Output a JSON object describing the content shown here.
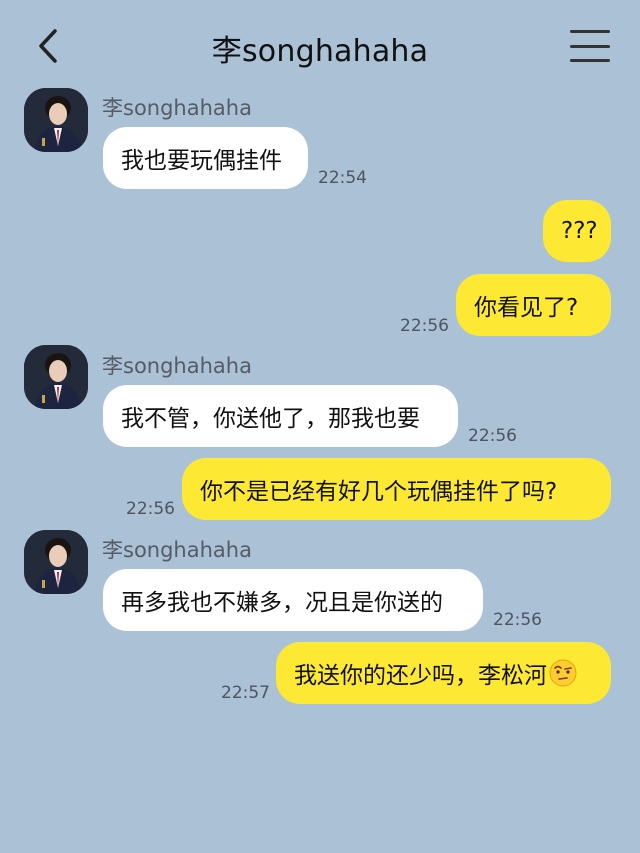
{
  "header": {
    "title": "李songhahaha"
  },
  "messages": [
    {
      "sender": "李songhahaha",
      "text": "我也要玩偶挂件",
      "time": "22:54"
    },
    {
      "text": "???"
    },
    {
      "text": "你看见了?",
      "time": "22:56"
    },
    {
      "sender": "李songhahaha",
      "text": "我不管，你送他了，那我也要",
      "time": "22:56"
    },
    {
      "text": "你不是已经有好几个玩偶挂件了吗?",
      "time": "22:56"
    },
    {
      "sender": "李songhahaha",
      "text": "再多我也不嫌多，况且是你送的",
      "time": "22:56"
    },
    {
      "text": "我送你的还少吗，李松河",
      "emoji": "raised-eyebrow-emoji",
      "time": "22:57"
    }
  ],
  "colors": {
    "background": "#abc1d6",
    "incoming_bubble": "#ffffff",
    "outgoing_bubble": "#fde933"
  }
}
